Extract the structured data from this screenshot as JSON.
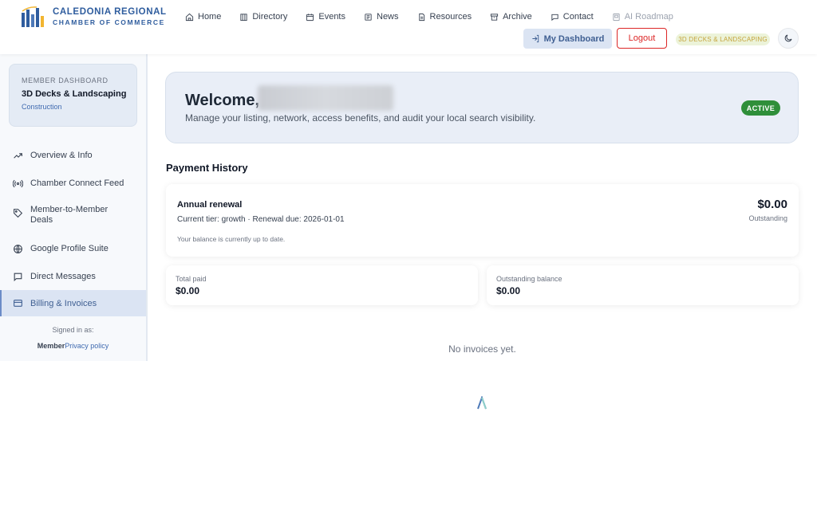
{
  "brand": {
    "line1": "CALEDONIA REGIONAL",
    "line2": "CHAMBER OF COMMERCE"
  },
  "nav": [
    {
      "label": "Home",
      "icon": "home-icon"
    },
    {
      "label": "Directory",
      "icon": "building-icon"
    },
    {
      "label": "Events",
      "icon": "calendar-icon"
    },
    {
      "label": "News",
      "icon": "newspaper-icon"
    },
    {
      "label": "Resources",
      "icon": "document-icon"
    },
    {
      "label": "Archive",
      "icon": "archive-icon"
    },
    {
      "label": "Contact",
      "icon": "chat-icon"
    },
    {
      "label": "AI Roadmap",
      "icon": "roadmap-icon",
      "disabled": true
    }
  ],
  "header": {
    "dashboard_label": "My Dashboard",
    "logout_label": "Logout",
    "business_tag": "3D DECKS & LANDSCAPING"
  },
  "sidebar": {
    "card": {
      "label": "MEMBER DASHBOARD",
      "name": "3D Decks & Landscaping",
      "category": "Construction"
    },
    "items": [
      {
        "label": "Overview & Info",
        "icon": "trend-icon"
      },
      {
        "label": "Chamber Connect Feed",
        "icon": "broadcast-icon"
      },
      {
        "label": "Member-to-Member Deals",
        "icon": "tag-icon"
      },
      {
        "label": "Google Profile Suite",
        "icon": "globe-icon"
      },
      {
        "label": "Direct Messages",
        "icon": "message-icon"
      },
      {
        "label": "Billing & Invoices",
        "icon": "credit-card-icon",
        "active": true
      }
    ],
    "signed_in_label": "Signed in as:",
    "role": "Member",
    "privacy_link": "Privacy policy"
  },
  "welcome": {
    "greeting": "Welcome,",
    "subtitle": "Manage your listing, network, access benefits, and audit your local search visibility.",
    "status": "ACTIVE"
  },
  "payment": {
    "section_title": "Payment History",
    "renewal_title": "Annual renewal",
    "renewal_details": "Current tier: growth · Renewal due: 2026-01-01",
    "renewal_note": "Your balance is currently up to date.",
    "amount": "$0.00",
    "amount_label": "Outstanding",
    "total_paid_label": "Total paid",
    "total_paid_value": "$0.00",
    "outstanding_label": "Outstanding balance",
    "outstanding_value": "$0.00",
    "empty_text": "No invoices yet."
  },
  "colors": {
    "brand": "#2f5d9e",
    "active_badge": "#2f8f3a",
    "logout": "#dc2626",
    "accent_bg": "#dbe4f3"
  }
}
